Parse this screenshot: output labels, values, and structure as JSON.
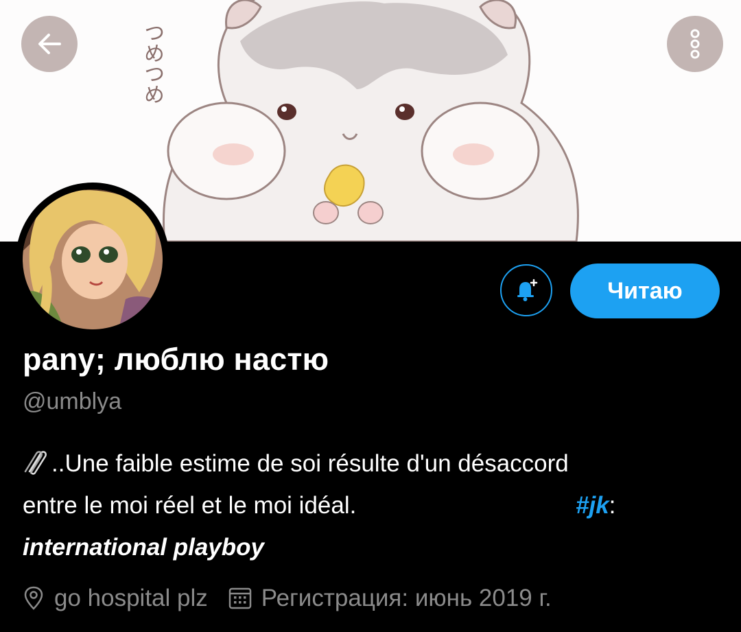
{
  "header": {
    "back_icon": "arrow-left-icon",
    "more_icon": "more-vertical-icon",
    "banner_scribble": "つめつめ"
  },
  "profile": {
    "display_name": "pany; люблю настю",
    "handle": "@umblya",
    "follow_label": "Читаю",
    "notify_icon": "bell-plus-icon"
  },
  "bio": {
    "emoji": "paperclip-icon",
    "line1": "..Une faible estime de soi résulte d'un désaccord",
    "line2": "entre le moi réel et le moi idéal.",
    "hashtag": "#jk",
    "hashtag_suffix": ":",
    "line3": "international playboy"
  },
  "meta": {
    "location_icon": "location-pin-icon",
    "location": "go hospital plz",
    "calendar_icon": "calendar-icon",
    "joined": "Регистрация: июнь 2019 г."
  },
  "colors": {
    "accent": "#1da1f2",
    "background": "#000000",
    "secondary_text": "#8b8b8b",
    "header_button": "#c3b5b3"
  }
}
